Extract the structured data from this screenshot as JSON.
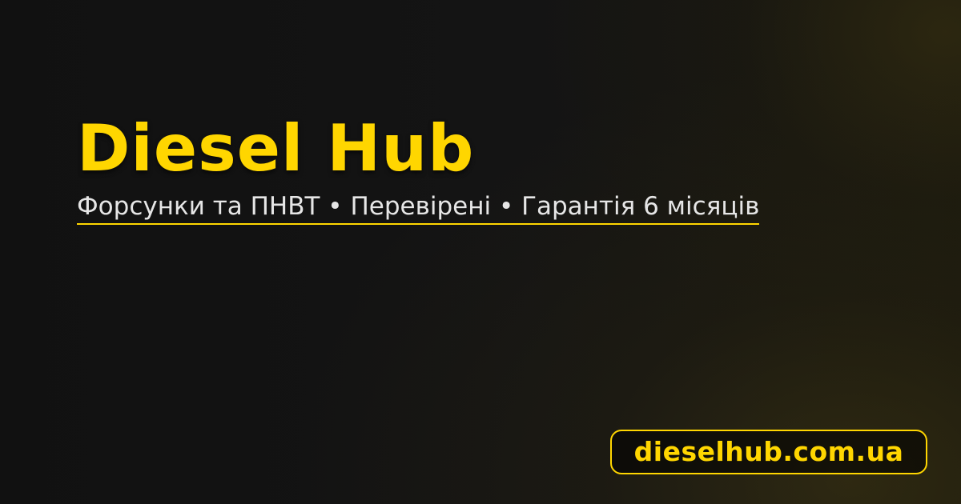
{
  "banner": {
    "title": "Diesel Hub",
    "subtitle": "Форсунки та ПНВТ • Перевірені • Гарантія 6 місяців",
    "domain": "dieselhub.com.ua"
  },
  "colors": {
    "background": "#121212",
    "accent": "#FFD600",
    "subtitle_text": "#E6E6E6"
  }
}
